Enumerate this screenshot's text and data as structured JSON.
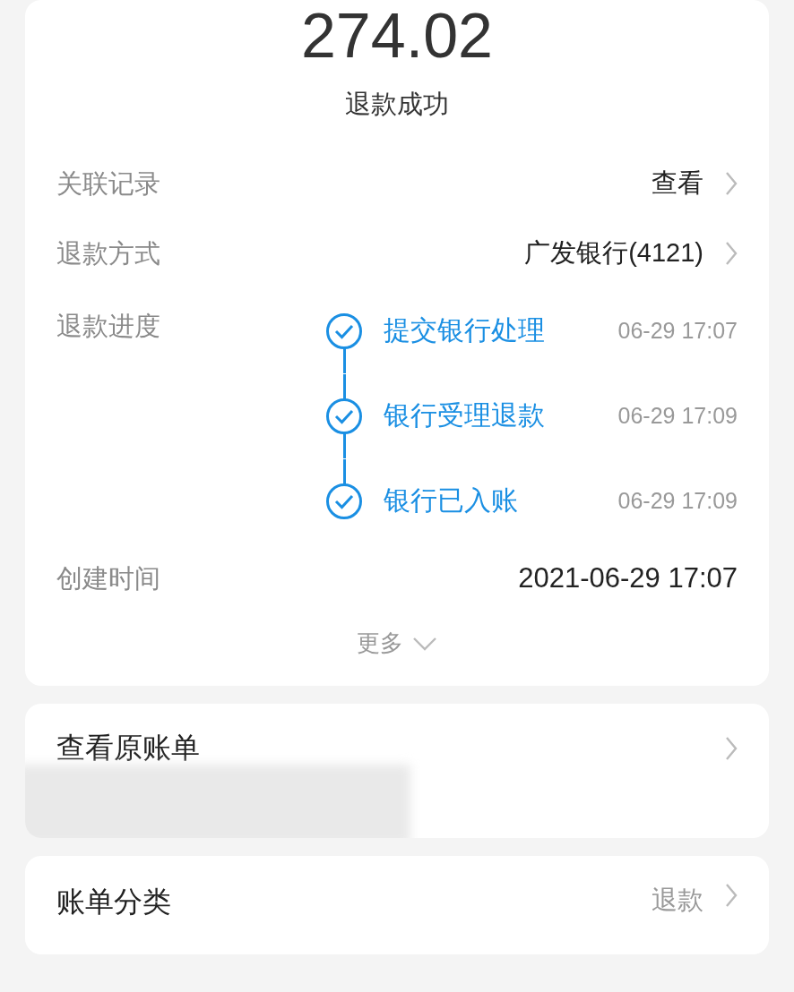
{
  "amount": "274.02",
  "status": "退款成功",
  "rows": [
    {
      "kind": "link",
      "label": "关联记录",
      "value": "查看"
    },
    {
      "kind": "link",
      "label": "退款方式",
      "value": "广发银行(4121)"
    },
    {
      "kind": "progress",
      "label": "退款进度",
      "steps": [
        {
          "title": "提交银行处理",
          "time": "06-29 17:07",
          "done": true
        },
        {
          "title": "银行受理退款",
          "time": "06-29 17:09",
          "done": true
        },
        {
          "title": "银行已入账",
          "time": "06-29 17:09",
          "done": true
        }
      ]
    },
    {
      "kind": "text",
      "label": "创建时间",
      "value": "2021-06-29 17:07"
    }
  ],
  "more": "更多",
  "original_bill": {
    "title": "查看原账单"
  },
  "category": {
    "label": "账单分类",
    "value": "退款"
  }
}
